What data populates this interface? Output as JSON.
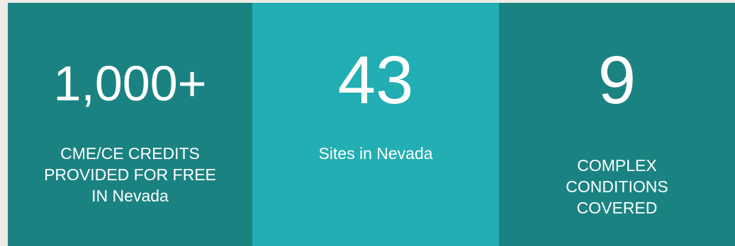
{
  "stats": [
    {
      "value": "1,000+",
      "label": "CME/CE CREDITS PROVIDED FOR FREE IN Nevada"
    },
    {
      "value": "43",
      "label": "Sites in Nevada"
    },
    {
      "value": "9",
      "label": "COMPLEX CONDITIONS COVERED"
    }
  ],
  "colors": {
    "page_background": "#eeebe6",
    "tile_dark": "#1b8282",
    "tile_light": "#22aeb2",
    "text": "#ffffff"
  }
}
